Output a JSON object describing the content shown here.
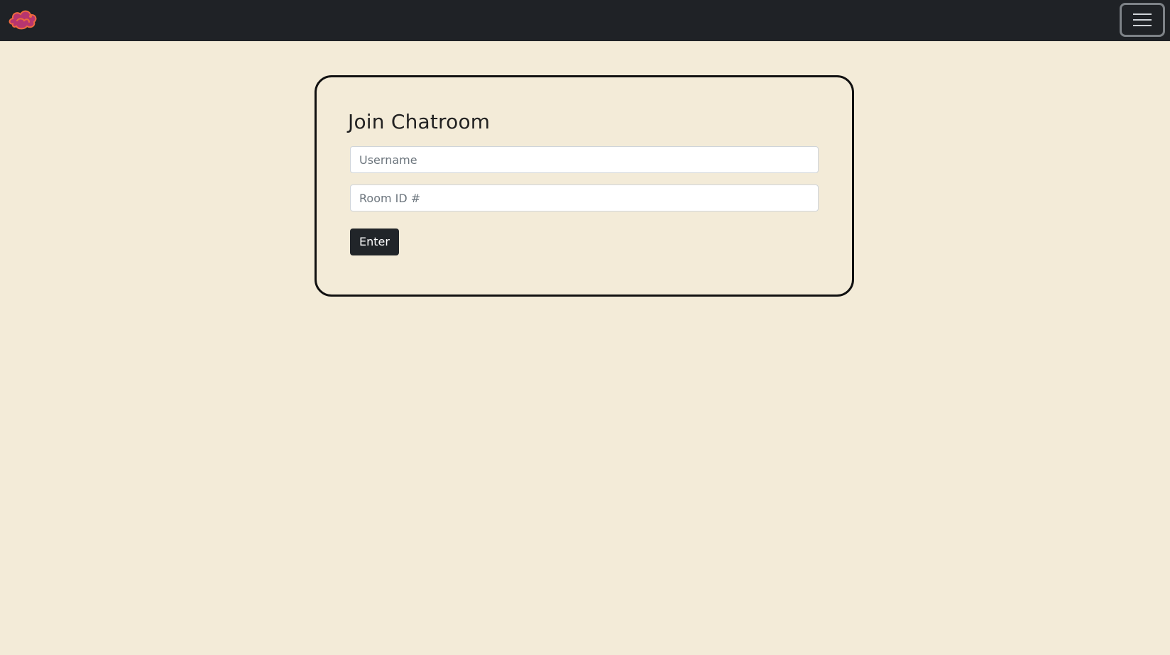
{
  "navbar": {
    "logo_icon": "pink-cloud-logo-icon",
    "menu_icon": "hamburger-menu-icon",
    "colors": {
      "background": "#1f2226",
      "toggle_border": "#7d8287"
    }
  },
  "join_form": {
    "title": "Join Chatroom",
    "username": {
      "value": "",
      "placeholder": "Username"
    },
    "room_id": {
      "value": "",
      "placeholder": "Room ID #"
    },
    "enter_label": "Enter"
  },
  "colors": {
    "page_background": "#f3ebd8",
    "button_background": "#212529",
    "logo_primary": "#b7356f",
    "logo_secondary": "#ef6a3f"
  }
}
